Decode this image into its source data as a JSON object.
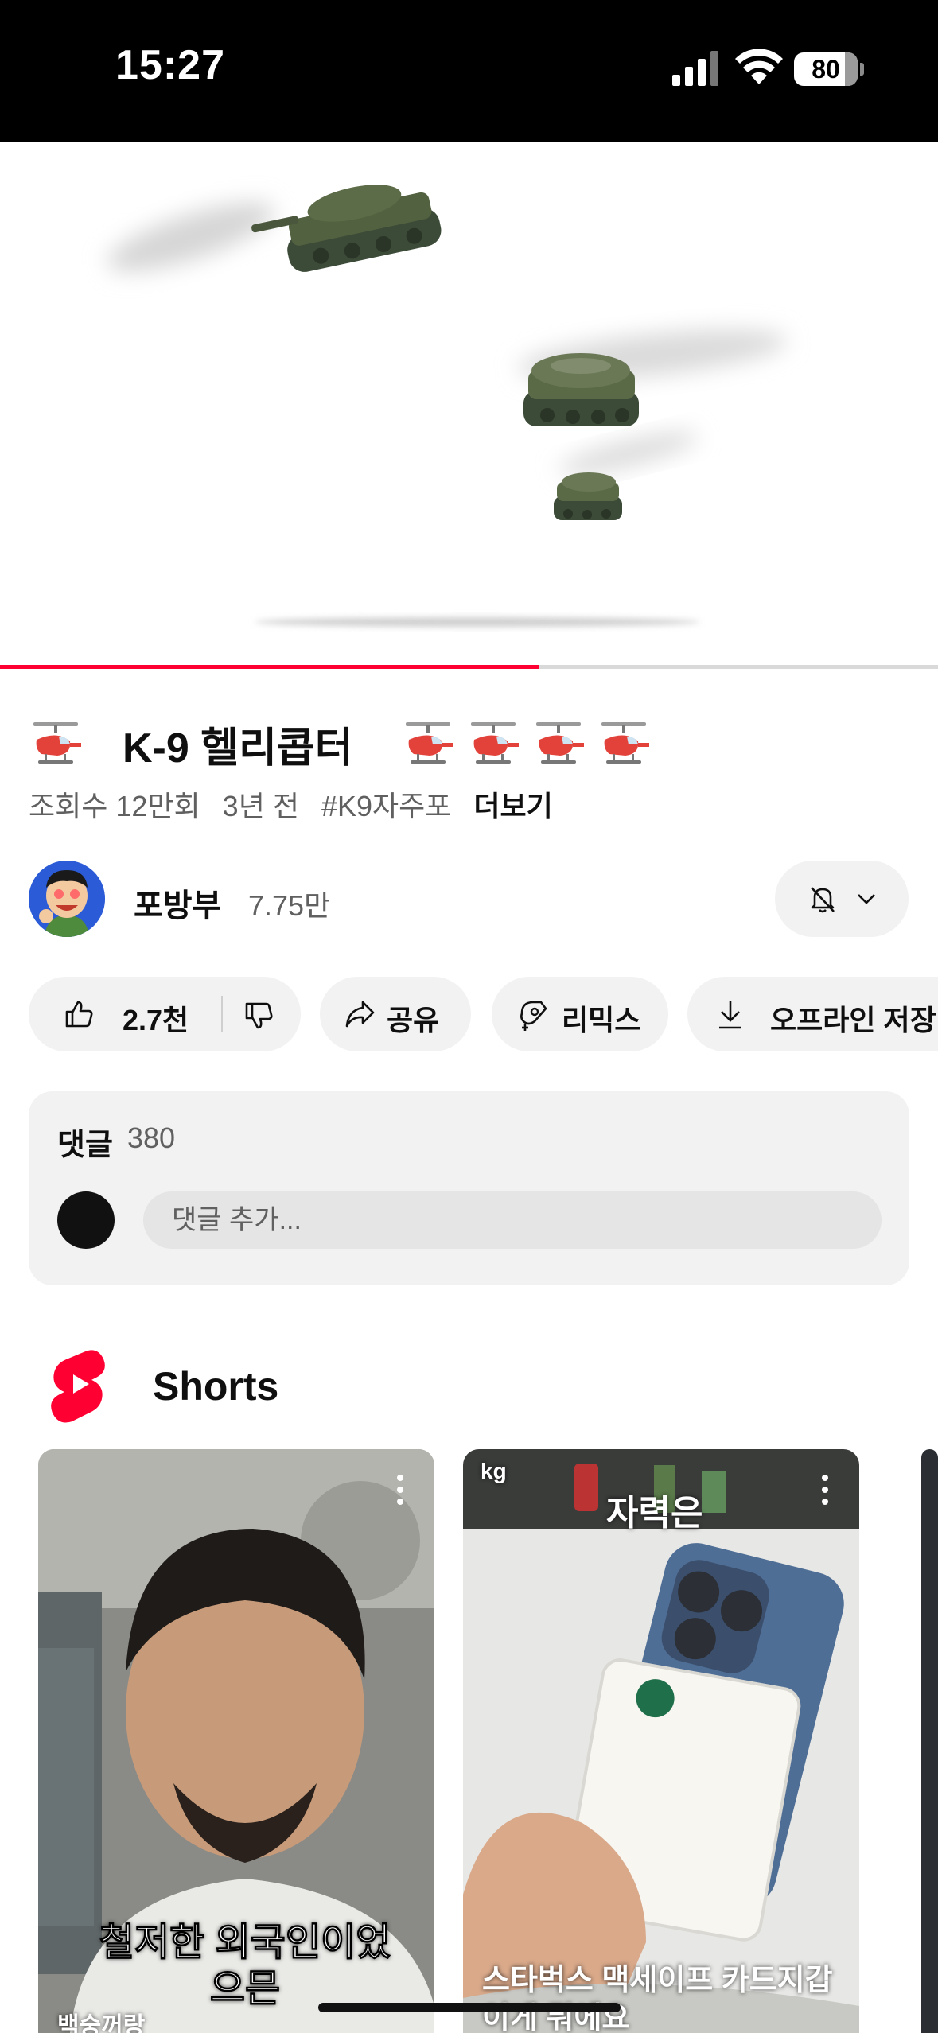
{
  "status_bar": {
    "time": "15:27",
    "battery": "80"
  },
  "video": {
    "progress_fraction": 0.575
  },
  "info": {
    "title": "K-9 헬리콥터",
    "views": "조회수 12만회",
    "age": "3년 전",
    "hashtag": "#K9자주포",
    "more": "더보기"
  },
  "channel": {
    "name": "포방부",
    "subscribers": "7.75만"
  },
  "actions": {
    "likes": "2.7천",
    "share": "공유",
    "remix": "리믹스",
    "download": "오프라인 저장"
  },
  "comments": {
    "label": "댓글",
    "count": "380",
    "placeholder": "댓글 추가..."
  },
  "shorts": {
    "heading": "Shorts",
    "cards": [
      {
        "overlay_text": "철저한 외국인이었으믄",
        "caption": "백숭꺼랑"
      },
      {
        "overlay_text": "자력은",
        "watermark": "kg",
        "caption": "스타벅스 맥세이프 카드지갑 이게 뭐에요"
      }
    ]
  },
  "colors": {
    "accent": "#ff0033",
    "pill_bg": "#f2f2f2",
    "text_secondary": "#606060"
  }
}
